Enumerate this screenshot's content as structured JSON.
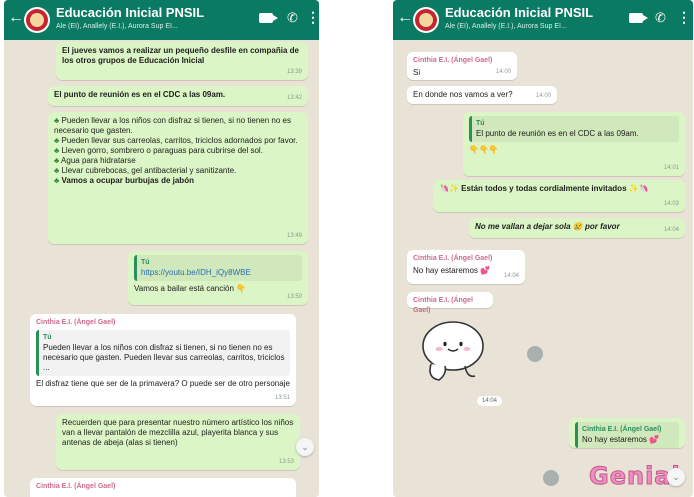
{
  "left_phone": {
    "header": {
      "title": "Educación Inicial PNSIL",
      "subtitle": "Ale (EI), Anallely (E.I.), Aurora Sup EI..."
    },
    "messages": {
      "m1": {
        "text": "El jueves vamos a realizar un pequeño desfile en compañia de los otros grupos de Educación Inicial",
        "time": "13:39"
      },
      "m2": {
        "text": "El punto de reunión es en el CDC a las 09am.",
        "time": "13:42"
      },
      "m3": {
        "items": [
          "Pueden llevar a los niños con disfraz si tienen, si no tienen no es necesario que gasten.",
          "Pueden llevar sus carreolas, carritos, triciclos adornados por favor.",
          "Lleven gorro, sombrero o paraguas para cubrirse del sol.",
          "Agua para hidratarse",
          "Llevar cubrebocas, gel antibacterial y sanitizante.",
          "Vamos a ocupar burbujas de jabón"
        ],
        "time": "13:49"
      },
      "m4": {
        "quote_name": "Tú",
        "quote_text": "https://youtu.be/IDH_iQy8WBE",
        "text": "Vamos a bailar está canción",
        "emoji": "👇",
        "time": "13:50"
      },
      "m5": {
        "sender": "Cinthia E.I. (Ángel Gael)",
        "quote_name": "Tú",
        "quote_text": "Pueden llevar a los niños con disfraz si tienen, si no tienen no es necesario que gasten. Pueden llevar sus carreolas, carritos, triciclos ...",
        "text": "El disfraz tiene que ser de la primavera? O puede ser de otro personaje",
        "time": "13:51"
      },
      "m6": {
        "text": "Recuerden que para presentar nuestro número artístico los niños van a llevar pantalón de mezclilla azul, playerita blanca y sus antenas de abeja (alas si tienen)",
        "time": "13:53"
      },
      "m7": {
        "sender": "Cinthia E.I. (Ángel Gael)"
      }
    }
  },
  "right_phone": {
    "header": {
      "title": "Educación Inicial PNSIL",
      "subtitle": "Ale (EI), Anallely (E.I.), Aurora Sup EI..."
    },
    "messages": {
      "r1": {
        "sender": "Cinthia E.I. (Ángel Gael)",
        "text": "Si",
        "time": "14:00"
      },
      "r2": {
        "text": "En donde nos vamos a ver?",
        "time": "14:00"
      },
      "r3": {
        "quote_name": "Tú",
        "quote_text": "El punto de reunión es en el CDC a las 09am.",
        "emoji": "👇👇👇",
        "time": "14:01"
      },
      "r4": {
        "text": "🦄✨ Están todos y todas cordialmente invitados ✨🦄",
        "time": "14:03"
      },
      "r5": {
        "text": "No me vallan a dejar sola 😢 por favor",
        "time": "14:04"
      },
      "r6": {
        "sender": "Cinthia E.I. (Ángel Gael)",
        "text": "No hay estaremos 💕",
        "time": "14:04"
      },
      "r7": {
        "sender": "Cinthia E.I. (Ángel Gael)",
        "time": "14:04"
      },
      "r8": {
        "quote_name": "Cinthia E.I. (Ángel Gael)",
        "quote_text": "No hay estaremos 💕"
      },
      "sticker_text": "Genial"
    }
  },
  "colors": {
    "header": "#0b7a62",
    "outgoing": "#dcf5c6",
    "incoming": "#ffffff",
    "chat_bg": "#e9e2d6"
  },
  "icons": [
    "back-arrow-icon",
    "video-call-icon",
    "phone-call-icon",
    "menu-dots-icon",
    "clover-icon",
    "scroll-down-icon",
    "forward-icon"
  ]
}
